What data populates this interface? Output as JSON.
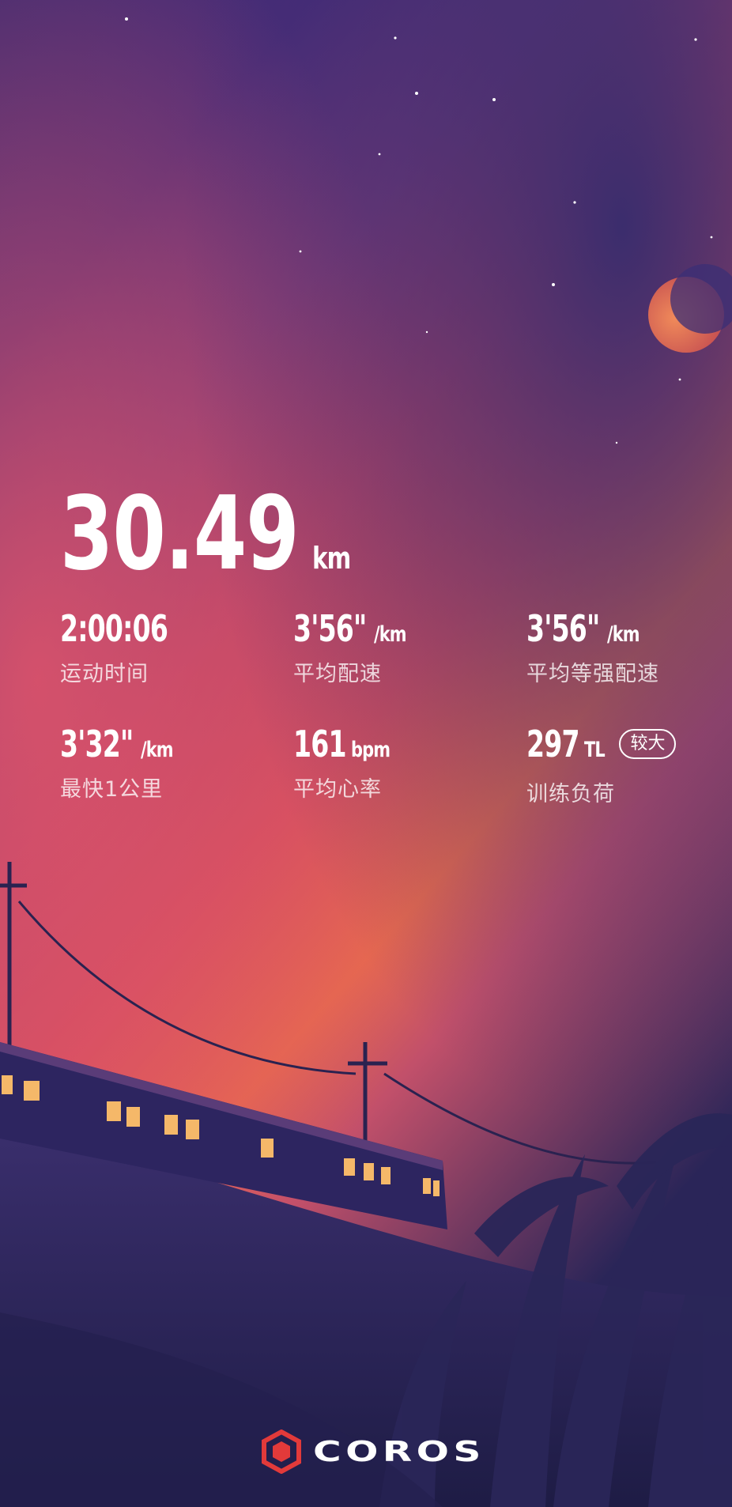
{
  "summary": {
    "distance": {
      "value": "30.49",
      "unit": "km"
    },
    "stats": [
      {
        "value": "2:00:06",
        "unit": "",
        "label": "运动时间"
      },
      {
        "value": "3'56\"",
        "unit": "/km",
        "label": "平均配速"
      },
      {
        "value": "3'56\"",
        "unit": "/km",
        "label": "平均等强配速"
      },
      {
        "value": "3'32\"",
        "unit": "/km",
        "label": "最快1公里"
      },
      {
        "value": "161",
        "unit": "bpm",
        "label": "平均心率"
      },
      {
        "value": "297",
        "unit": "TL",
        "label": "训练负荷",
        "badge": "较大"
      }
    ]
  },
  "brand": {
    "name": "COROS",
    "logo_color": "#e23a3a"
  }
}
